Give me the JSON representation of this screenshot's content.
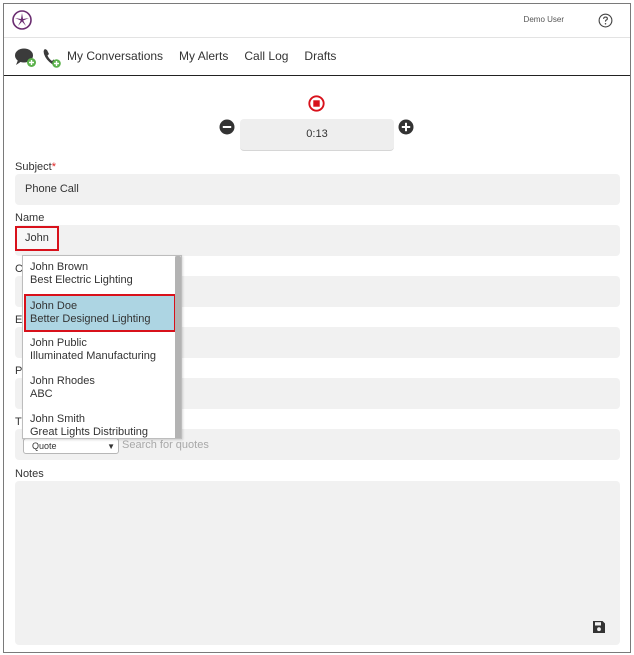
{
  "header": {
    "user_name": "Demo User"
  },
  "nav": {
    "links": [
      "My Conversations",
      "My Alerts",
      "Call Log",
      "Drafts"
    ]
  },
  "timer": {
    "value": "0:13"
  },
  "form": {
    "subject_label": "Subject",
    "required_mark": "*",
    "subject_value": "Phone Call",
    "name_label": "Name",
    "name_value": "John",
    "cut_labels": [
      "C",
      "E",
      "P",
      "T"
    ],
    "notes_label": "Notes",
    "quote_select": "Quote",
    "quote_search_placeholder": "Search for quotes"
  },
  "dropdown": {
    "items": [
      {
        "name": "John Brown",
        "company": "Best Electric Lighting"
      },
      {
        "name": "John Doe",
        "company": "Better Designed Lighting"
      },
      {
        "name": "John Public",
        "company": "Illuminated Manufacturing"
      },
      {
        "name": "John Rhodes",
        "company": "ABC"
      },
      {
        "name": "John Smith",
        "company": "Great Lights Distributing"
      }
    ],
    "highlighted_index": 1
  },
  "colors": {
    "accent_red": "#d8111b",
    "highlight_blue": "#add5e3"
  }
}
